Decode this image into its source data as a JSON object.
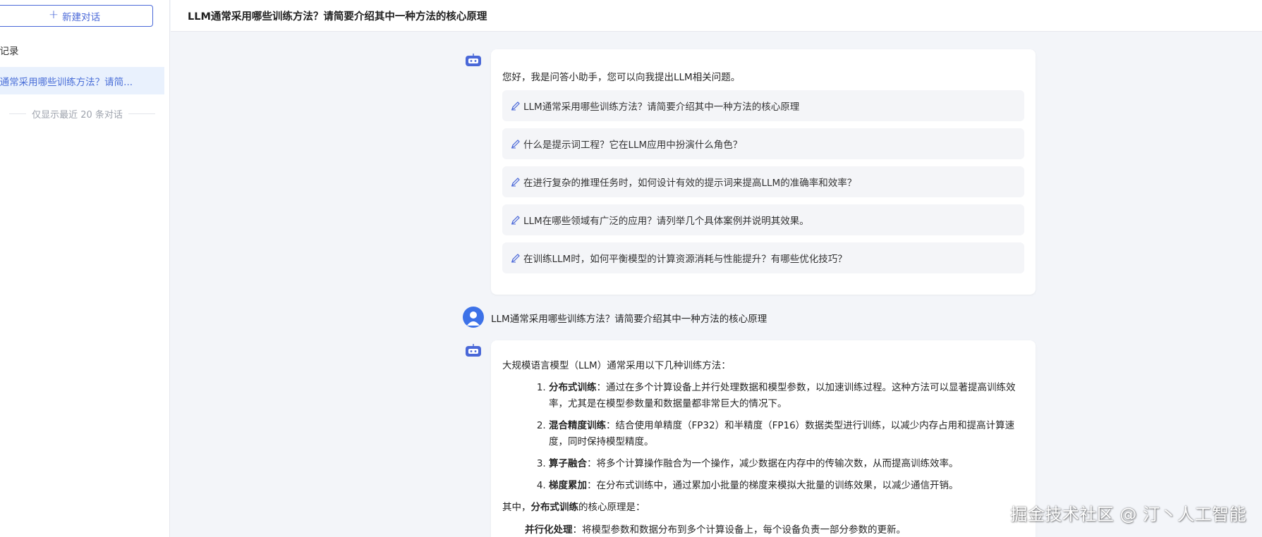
{
  "sidebar": {
    "new_chat_label": "新建对话",
    "history_title": "史记录",
    "history_items": [
      {
        "label": "M通常采用哪些训练方法？请简..."
      }
    ],
    "history_note": "仅显示最近 20 条对话"
  },
  "header": {
    "title": "LLM通常采用哪些训练方法？请简要介绍其中一种方法的核心原理"
  },
  "chat": {
    "greeting": "您好，我是问答小助手，您可以向我提出LLM相关问题。",
    "suggestions": [
      "LLM通常采用哪些训练方法？请简要介绍其中一种方法的核心原理",
      "什么是提示词工程？它在LLM应用中扮演什么角色？",
      "在进行复杂的推理任务时，如何设计有效的提示词来提高LLM的准确率和效率？",
      "LLM在哪些领域有广泛的应用？请列举几个具体案例并说明其效果。",
      "在训练LLM时，如何平衡模型的计算资源消耗与性能提升？有哪些优化技巧？"
    ],
    "user_message": "LLM通常采用哪些训练方法？请简要介绍其中一种方法的核心原理",
    "answer": {
      "intro": "大规模语言模型（LLM）通常采用以下几种训练方法：",
      "items": [
        {
          "title": "分布式训练",
          "text": "：通过在多个计算设备上并行处理数据和模型参数，以加速训练过程。这种方法可以显著提高训练效率，尤其是在模型参数量和数据量都非常巨大的情况下。"
        },
        {
          "title": "混合精度训练",
          "text": "：结合使用单精度（FP32）和半精度（FP16）数据类型进行训练，以减少内存占用和提高计算速度，同时保持模型精度。"
        },
        {
          "title": "算子融合",
          "text": "：将多个计算操作融合为一个操作，减少数据在内存中的传输次数，从而提高训练效率。"
        },
        {
          "title": "梯度累加",
          "text": "：在分布式训练中，通过累加小批量的梯度来模拟大批量的训练效果，以减少通信开销。"
        }
      ],
      "para_prefix": "其中，",
      "para_bold": "分布式训练",
      "para_suffix": "的核心原理是：",
      "sub_title": "并行化处理",
      "sub_text": "：将模型参数和数据分布到多个计算设备上，每个设备负责一部分参数的更新。"
    }
  },
  "watermark": "掘金技术社区 @ 汀丶人工智能",
  "colors": {
    "accent": "#4a68d8",
    "history_active_bg": "#e9f1fd",
    "page_bg": "#f3f5f9",
    "user_avatar": "#3d72e8"
  }
}
